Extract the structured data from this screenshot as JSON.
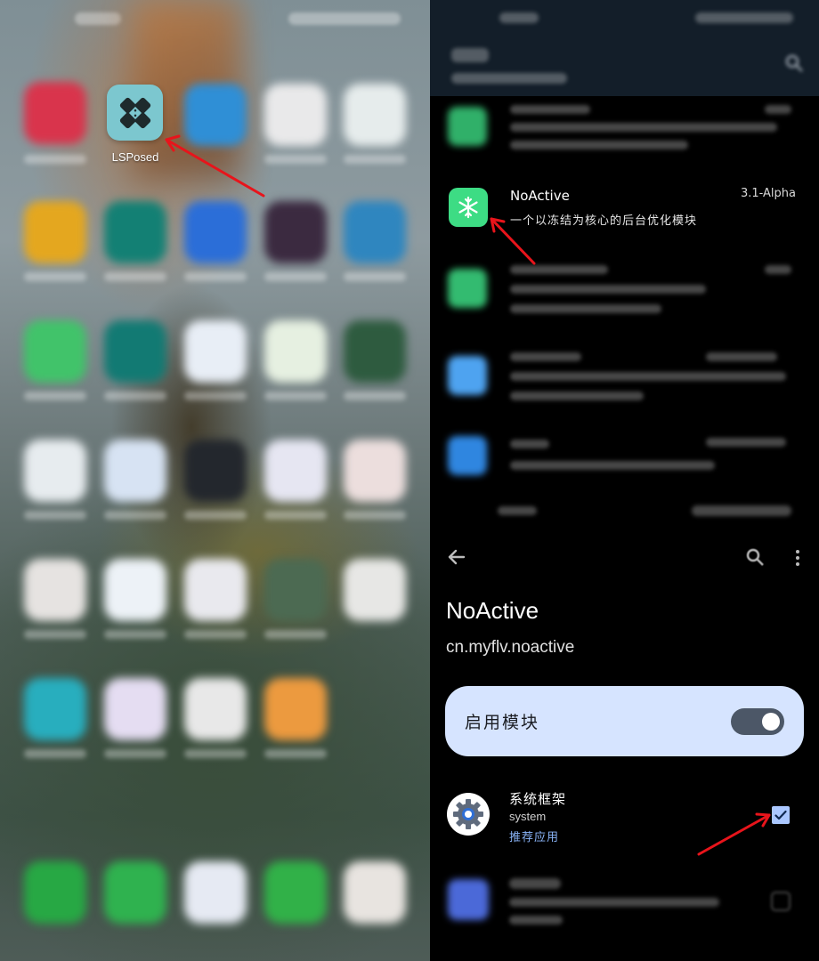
{
  "home_screen": {
    "featured_app": {
      "label": "LSPosed",
      "icon": "lsposed-bandage-icon",
      "color": "#7cc7cf"
    },
    "blurred_app_colors": [
      "#d9344c",
      "#2f8fd6",
      "#e9e9ea",
      "#e6ecec",
      "#e4a71f",
      "#138074",
      "#2b6ed8",
      "#3b2a40",
      "#2f86bf",
      "#41c36a",
      "#127a73",
      "#e8eef6",
      "#e6f0e1",
      "#2e5b3f",
      "#e7ecef",
      "#d7e3f3",
      "#23272d",
      "#e6e6f2",
      "#ecdedd",
      "#e6e3e1",
      "#edf2f7",
      "#e9e9ee",
      "#4c6a52",
      "#e7e7e5",
      "#28aebe",
      "#e5ddf2",
      "#e8e8e8",
      "#ec9a3f",
      "#27a844",
      "#2fb24f",
      "#e6eaf3",
      "#31b148",
      "#e8e4e0"
    ]
  },
  "module_list": {
    "highlighted": {
      "name": "NoActive",
      "version": "3.1-Alpha",
      "description": "一个以冻结为核心的后台优化模块",
      "icon": "snowflake-icon",
      "icon_color": "#3ddc84"
    }
  },
  "detail": {
    "title": "NoActive",
    "package": "cn.myflv.noactive",
    "enable_label": "启用模块",
    "enabled": true,
    "scope": [
      {
        "name": "系统框架",
        "package": "system",
        "tag": "推荐应用",
        "checked": true,
        "icon": "android-gear-icon"
      }
    ]
  },
  "colors": {
    "accent_card": "#d6e4ff",
    "toggle_track": "#4c5767",
    "checkbox": "#aac7ff",
    "tag_text": "#8ab4f8",
    "annotation_arrow": "#e8141b"
  }
}
